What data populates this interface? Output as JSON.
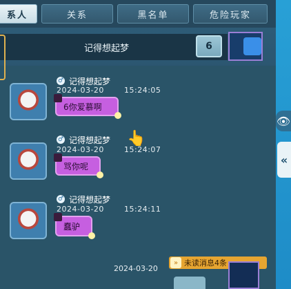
{
  "tabs": [
    {
      "label": "系人"
    },
    {
      "label": "关系"
    },
    {
      "label": "黑名单"
    },
    {
      "label": "危险玩家"
    }
  ],
  "chat": {
    "title": "记得想起梦",
    "unread_counter": "6"
  },
  "messages": [
    {
      "sender": "记得想起梦",
      "date": "2024-03-20",
      "time": "15:24:05",
      "text": "6你爱慕啊"
    },
    {
      "sender": "记得想起梦",
      "date": "2024-03-20",
      "time": "15:24:07",
      "text": "骂你呢"
    },
    {
      "sender": "记得想起梦",
      "date": "2024-03-20",
      "time": "15:24:11",
      "text": "蠢驴"
    }
  ],
  "footer": {
    "partial_date": "2024-03-20",
    "unread_label": "未读消息4条"
  },
  "icons": {
    "gender": "male-icon",
    "side": "eye-icon",
    "collapse": "collapse-arrows-icon",
    "hand": "pointer-hand-icon"
  },
  "colors": {
    "bubble": "#c65fe0",
    "tab_active": "#eaf3f6",
    "unread": "#e6a531",
    "strip": "#28a0d6"
  }
}
